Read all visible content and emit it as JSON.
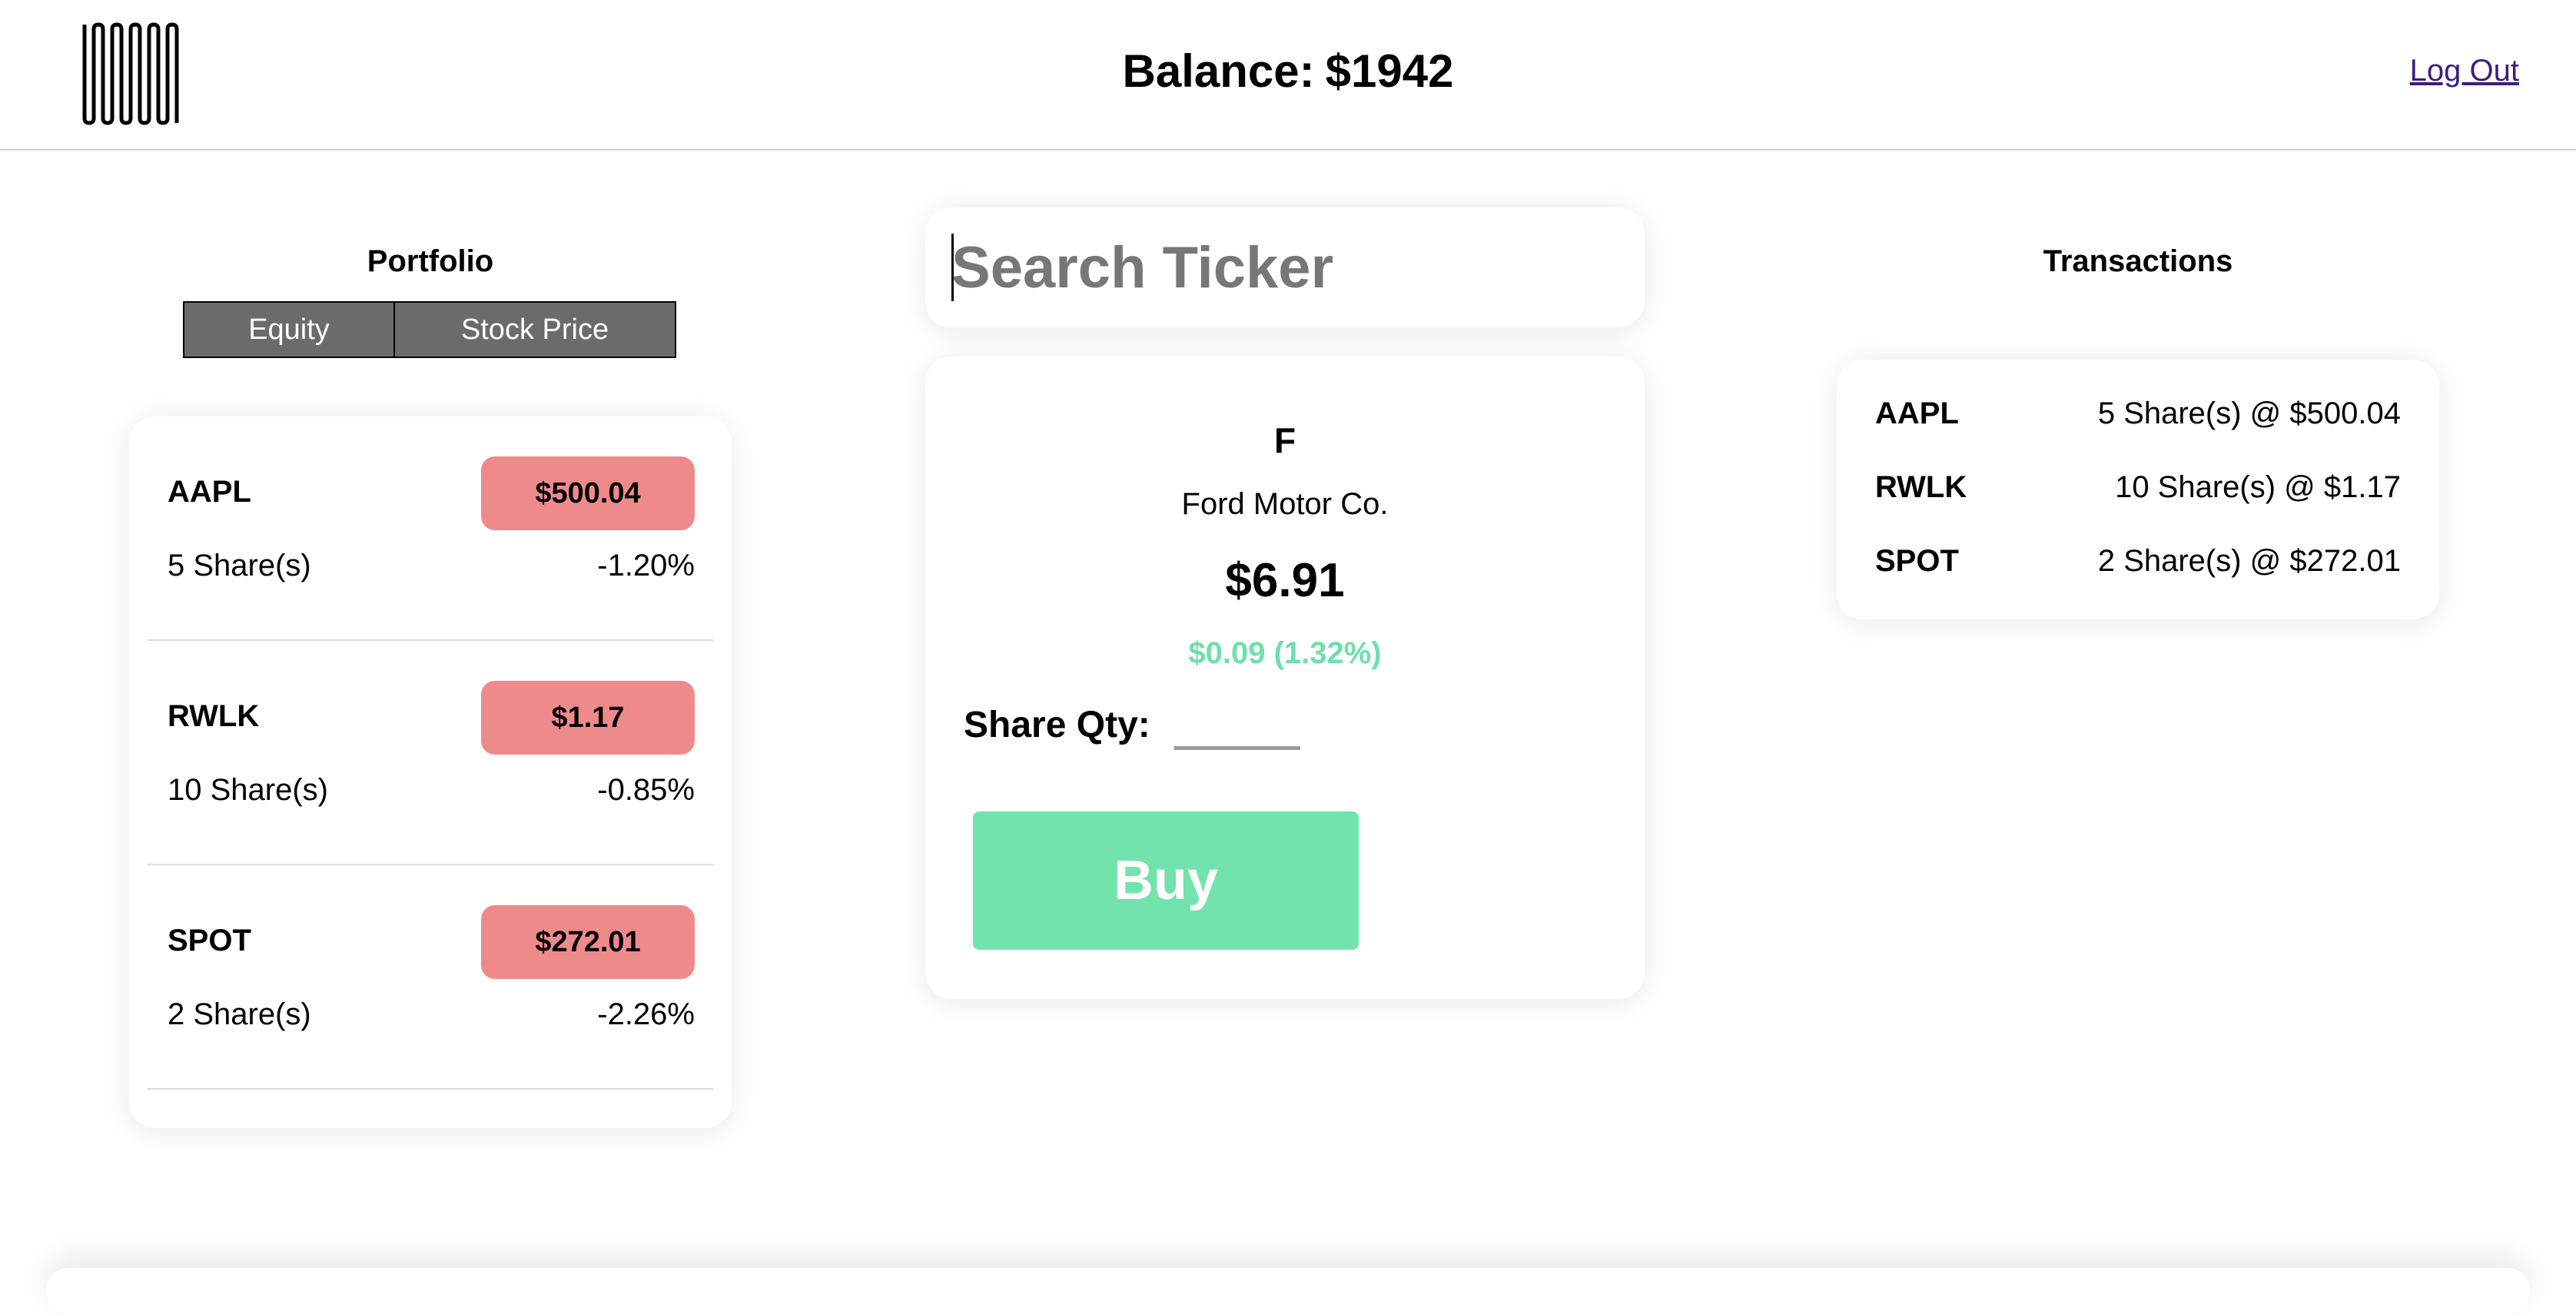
{
  "header": {
    "balance_label": "Balance:",
    "balance_value": "$1942",
    "logout_label": "Log Out"
  },
  "portfolio": {
    "title": "Portfolio",
    "sort_equity": "Equity",
    "sort_price": "Stock Price",
    "holdings": [
      {
        "symbol": "AAPL",
        "price": "$500.04",
        "shares": "5 Share(s)",
        "change": "-1.20%"
      },
      {
        "symbol": "RWLK",
        "price": "$1.17",
        "shares": "10 Share(s)",
        "change": "-0.85%"
      },
      {
        "symbol": "SPOT",
        "price": "$272.01",
        "shares": "2 Share(s)",
        "change": "-2.26%"
      }
    ]
  },
  "search": {
    "placeholder": "Search Ticker"
  },
  "stock": {
    "ticker": "F",
    "name": "Ford Motor Co.",
    "price": "$6.91",
    "change": "$0.09 (1.32%)",
    "qty_label": "Share Qty:",
    "buy_label": "Buy"
  },
  "transactions": {
    "title": "Transactions",
    "items": [
      {
        "symbol": "AAPL",
        "detail": "5 Share(s) @ $500.04"
      },
      {
        "symbol": "RWLK",
        "detail": "10 Share(s) @ $1.17"
      },
      {
        "symbol": "SPOT",
        "detail": "2 Share(s) @ $272.01"
      }
    ]
  },
  "colors": {
    "loss_badge": "#ef8a8a",
    "gain_text": "#6ee0ab",
    "buy_button": "#72e3ad",
    "sort_button": "#6b6b6b",
    "link": "#3b1f7a"
  },
  "icons": {
    "logo": "zigzag-logo-icon"
  }
}
